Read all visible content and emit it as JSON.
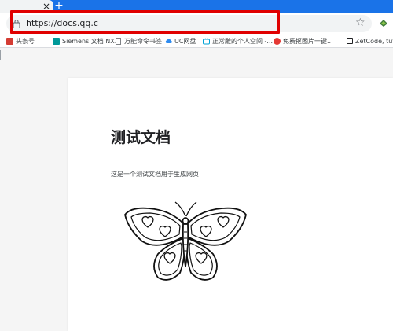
{
  "tabs": {
    "close_glyph": "×",
    "new_tab_glyph": "+"
  },
  "omnibox": {
    "url": "https://docs.qq.c"
  },
  "toolbar": {
    "star_glyph": "☆"
  },
  "bookmarks": [
    {
      "label": "头条号",
      "icon": "toutiao-icon",
      "color": "#d43c33"
    },
    {
      "label": "Siemens 文档 NX...",
      "icon": "siemens-icon",
      "color": "#009999"
    },
    {
      "label": "万能命令书签",
      "icon": "document-icon",
      "color": "#5f6368"
    },
    {
      "label": "UC网盘",
      "icon": "cloud-icon",
      "color": "#2f8cf0"
    },
    {
      "label": "正常雕的个人空间 -...",
      "icon": "tv-icon",
      "color": "#00a1d6"
    },
    {
      "label": "免费抠图片一键...",
      "icon": "scissors-icon",
      "color": "#e53935"
    },
    {
      "label": "ZetCode, tutori",
      "icon": "square-icon",
      "color": "#202124"
    }
  ],
  "document": {
    "title": "测试文档",
    "body": "这是一个测试文档用于生成网页"
  },
  "colors": {
    "tabstrip": "#1a73e8",
    "highlight": "#e00000"
  }
}
